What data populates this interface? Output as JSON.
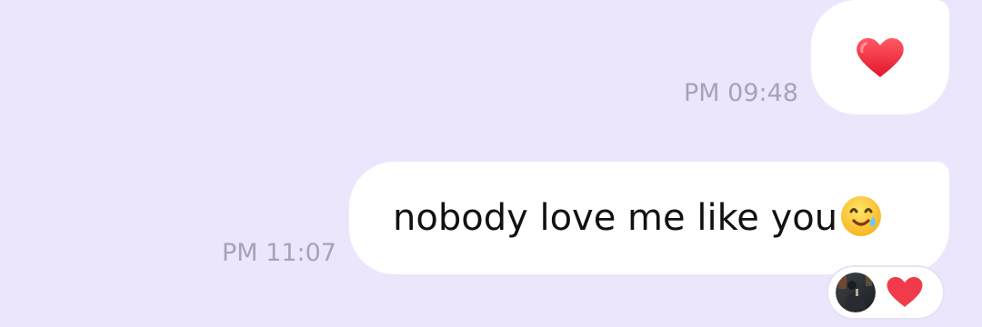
{
  "messages": [
    {
      "time": "PM 09:48",
      "content": {
        "emoji": "heart-icon"
      }
    },
    {
      "time": "PM 11:07",
      "content": {
        "text": "nobody love me like you",
        "emoji": "smiling-face-with-tear-icon"
      }
    }
  ],
  "reaction": {
    "emoji": "heart-icon"
  },
  "colors": {
    "background": "#ECE6FD",
    "bubble": "#FFFFFF",
    "timestamp": "#A8A2B6",
    "heart": "#F23B4A"
  }
}
